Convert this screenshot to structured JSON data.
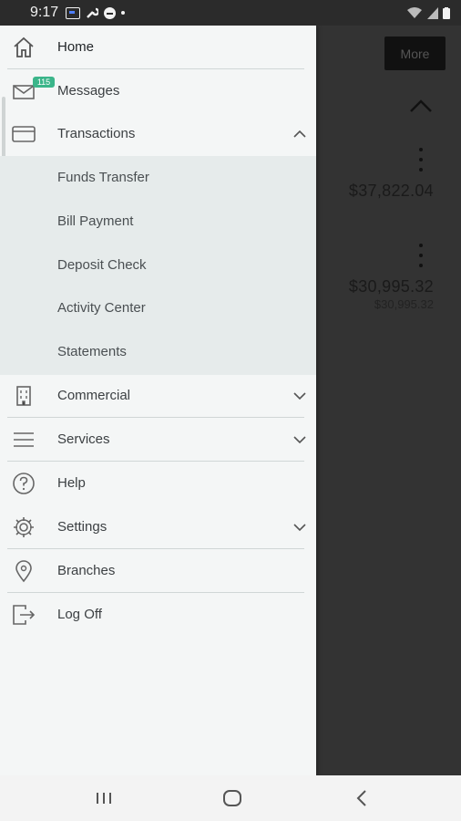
{
  "status_bar": {
    "time": "9:17"
  },
  "background": {
    "more_label": "More",
    "accounts": [
      {
        "balance": "$37,822.04"
      },
      {
        "balance": "$30,995.32",
        "sub_balance": "$30,995.32"
      }
    ]
  },
  "drawer": {
    "items": [
      {
        "label": "Home",
        "icon": "home-icon"
      },
      {
        "label": "Messages",
        "icon": "mail-icon",
        "badge": "115"
      },
      {
        "label": "Transactions",
        "icon": "card-icon",
        "expanded": true
      },
      {
        "label": "Commercial",
        "icon": "building-icon"
      },
      {
        "label": "Services",
        "icon": "menu-icon"
      },
      {
        "label": "Help",
        "icon": "help-icon"
      },
      {
        "label": "Settings",
        "icon": "gear-icon"
      },
      {
        "label": "Branches",
        "icon": "location-pin-icon"
      },
      {
        "label": "Log Off",
        "icon": "logout-icon"
      }
    ],
    "transactions_submenu": [
      {
        "label": "Funds Transfer"
      },
      {
        "label": "Bill Payment"
      },
      {
        "label": "Deposit Check"
      },
      {
        "label": "Activity Center"
      },
      {
        "label": "Statements"
      }
    ]
  },
  "colors": {
    "drawer_bg": "#f4f6f6",
    "submenu_bg": "#e6ebeb",
    "badge": "#3bb58a",
    "overlay": "#333333"
  }
}
